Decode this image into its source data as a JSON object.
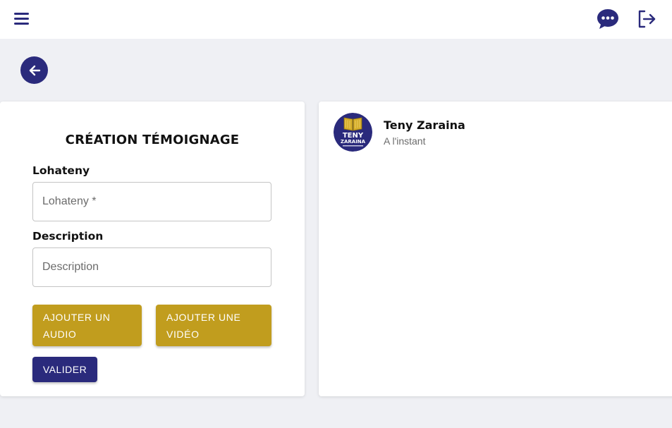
{
  "header": {
    "menu_icon": "hamburger-menu-icon",
    "chat_icon": "chat-bubble-icon",
    "logout_icon": "logout-icon",
    "accent_color": "#2a2a7c"
  },
  "back_button": {
    "icon": "arrow-left-icon"
  },
  "form": {
    "title": "CRÉATION TÉMOIGNAGE",
    "title_label": "Lohateny",
    "title_placeholder": "Lohateny *",
    "title_value": "",
    "description_label": "Description",
    "description_placeholder": "Description",
    "description_value": "",
    "add_audio_label": "AJOUTER UN AUDIO",
    "add_video_label": "AJOUTER UNE VIDÉO",
    "submit_label": "VALIDER",
    "gold_color": "#c19d1e"
  },
  "preview": {
    "author_name": "Teny Zaraina",
    "timestamp": "A l'instant",
    "avatar_text": "TENY ZARAINA"
  }
}
